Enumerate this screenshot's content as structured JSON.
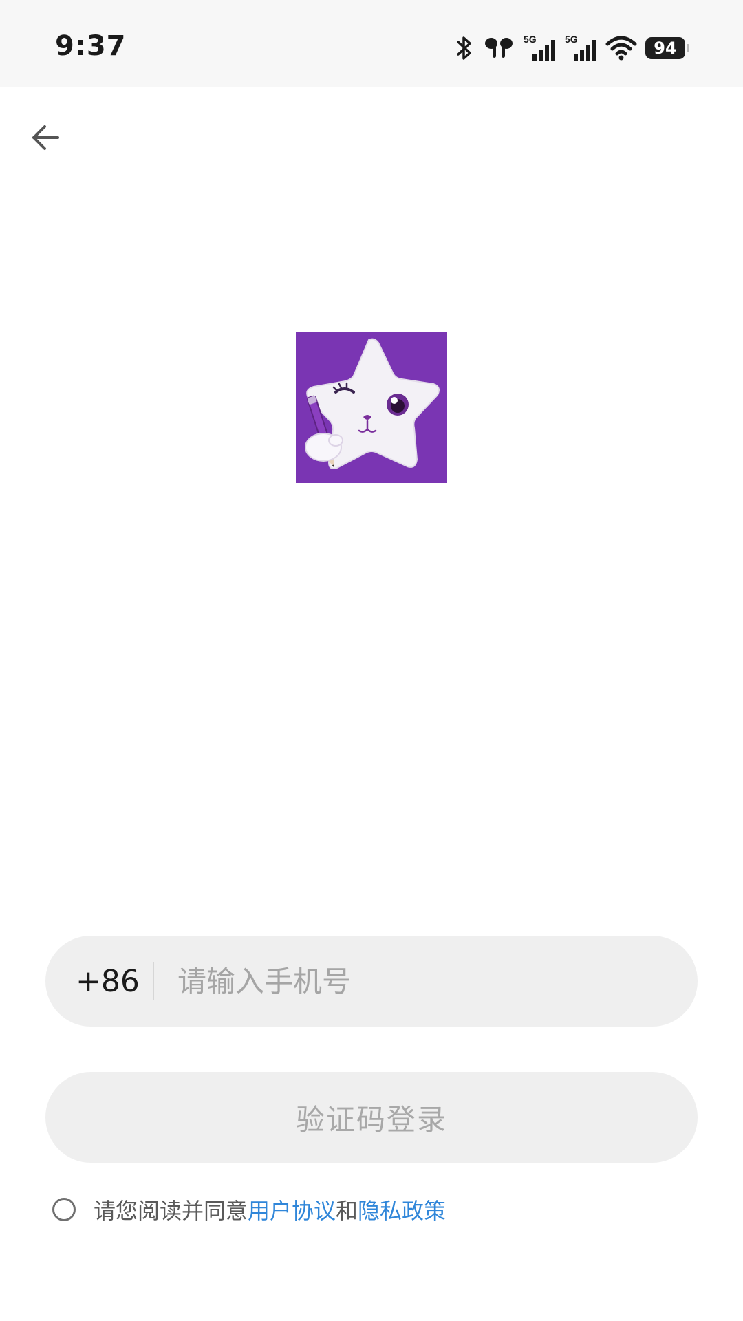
{
  "status_bar": {
    "time": "9:37",
    "battery_level": "94",
    "network_1": "5G",
    "network_2": "5G",
    "icons": [
      "bluetooth-icon",
      "earbuds-icon",
      "signal-5g-icon",
      "signal-5g-icon",
      "wifi-icon",
      "battery-icon"
    ]
  },
  "header": {
    "back_icon": "arrow-left-icon"
  },
  "logo": {
    "icon": "star-mascot-logo",
    "background_color": "#7a35b3"
  },
  "phone": {
    "country_code": "+86",
    "placeholder": "请输入手机号",
    "value": ""
  },
  "login": {
    "button_label": "验证码登录"
  },
  "agreement": {
    "prefix": "请您阅读并同意",
    "user_agreement": "用户协议",
    "conjunction": "和",
    "privacy_policy": "隐私政策",
    "link_color": "#2f86d9"
  }
}
